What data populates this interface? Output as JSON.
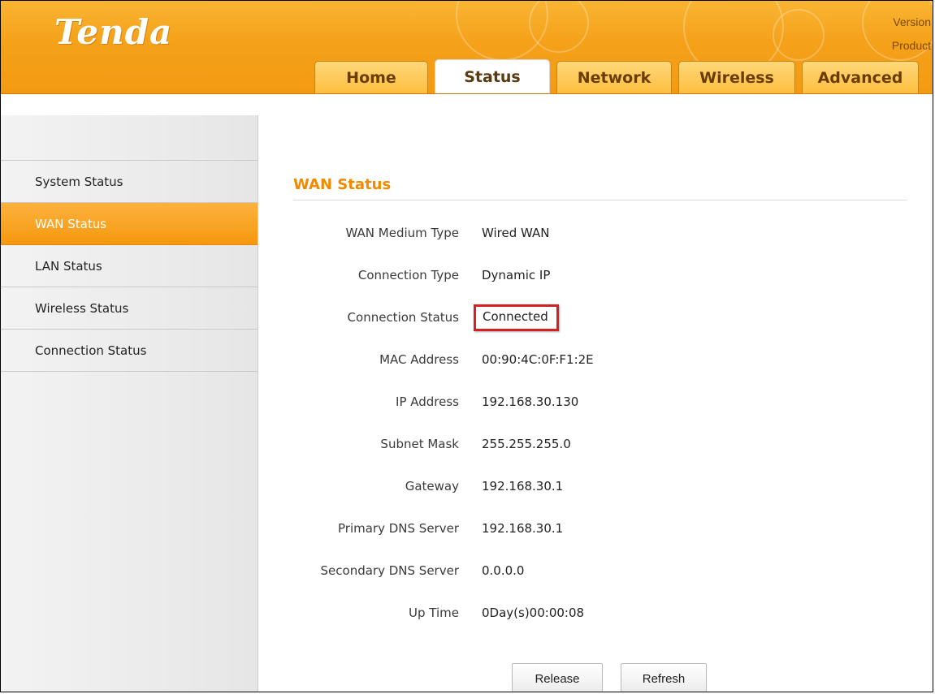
{
  "header": {
    "logo": "Tenda",
    "version_label": "Version",
    "product_label": "Product"
  },
  "tabs": [
    {
      "label": "Home",
      "active": false
    },
    {
      "label": "Status",
      "active": true
    },
    {
      "label": "Network",
      "active": false
    },
    {
      "label": "Wireless",
      "active": false
    },
    {
      "label": "Advanced",
      "active": false
    }
  ],
  "sidebar": {
    "items": [
      {
        "label": "System Status",
        "active": false
      },
      {
        "label": "WAN Status",
        "active": true
      },
      {
        "label": "LAN Status",
        "active": false
      },
      {
        "label": "Wireless Status",
        "active": false
      },
      {
        "label": "Connection Status",
        "active": false
      }
    ]
  },
  "main": {
    "title": "WAN Status",
    "rows": [
      {
        "label": "WAN Medium Type",
        "value": "Wired WAN"
      },
      {
        "label": "Connection Type",
        "value": "Dynamic IP"
      },
      {
        "label": "Connection Status",
        "value": "Connected"
      },
      {
        "label": "MAC Address",
        "value": "00:90:4C:0F:F1:2E"
      },
      {
        "label": "IP Address",
        "value": "192.168.30.130"
      },
      {
        "label": "Subnet Mask",
        "value": "255.255.255.0"
      },
      {
        "label": "Gateway",
        "value": "192.168.30.1"
      },
      {
        "label": "Primary DNS Server",
        "value": "192.168.30.1"
      },
      {
        "label": "Secondary DNS Server",
        "value": "0.0.0.0"
      },
      {
        "label": "Up Time",
        "value": "0Day(s)00:00:08"
      }
    ],
    "buttons": {
      "release": "Release",
      "refresh": "Refresh"
    }
  },
  "colors": {
    "accent": "#f5a11a",
    "title": "#f08a00",
    "highlight_box": "#d42020"
  }
}
